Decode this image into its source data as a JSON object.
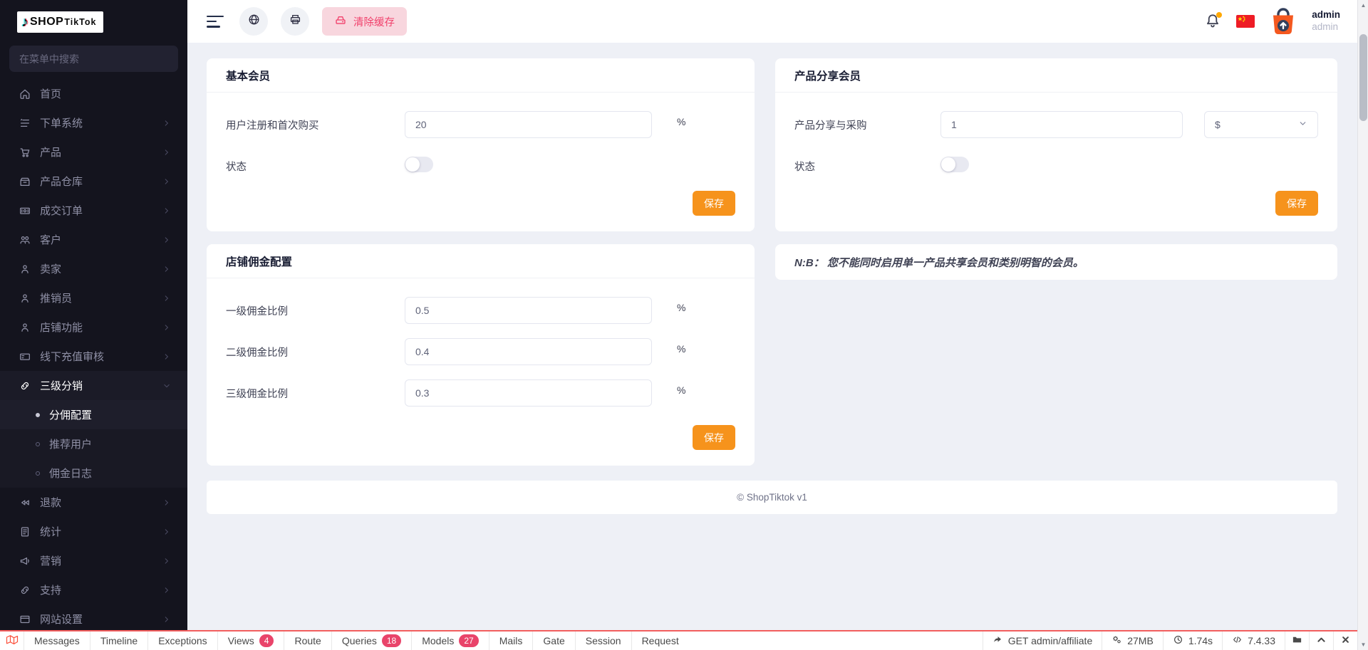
{
  "brand": {
    "shop": "SHOP",
    "tiktok": "TikTok"
  },
  "sidebar": {
    "search_placeholder": "在菜单中搜索",
    "items": [
      {
        "label": "首页",
        "icon": "home-icon"
      },
      {
        "label": "下单系统",
        "icon": "order-list-icon"
      },
      {
        "label": "产品",
        "icon": "cart-icon"
      },
      {
        "label": "产品仓库",
        "icon": "warehouse-icon"
      },
      {
        "label": "成交订单",
        "icon": "order-receipt-icon"
      },
      {
        "label": "客户",
        "icon": "customers-icon"
      },
      {
        "label": "卖家",
        "icon": "user-icon"
      },
      {
        "label": "推销员",
        "icon": "user-icon"
      },
      {
        "label": "店铺功能",
        "icon": "user-icon"
      },
      {
        "label": "线下充值审核",
        "icon": "card-icon"
      },
      {
        "label": "三级分销",
        "icon": "link-icon",
        "expanded": true,
        "children": [
          {
            "label": "分佣配置",
            "active": true
          },
          {
            "label": "推荐用户",
            "active": false
          },
          {
            "label": "佣金日志",
            "active": false
          }
        ]
      },
      {
        "label": "退款",
        "icon": "rewind-icon"
      },
      {
        "label": "统计",
        "icon": "file-icon"
      },
      {
        "label": "营销",
        "icon": "megaphone-icon"
      },
      {
        "label": "支持",
        "icon": "link-icon"
      },
      {
        "label": "网站设置",
        "icon": "window-icon"
      }
    ]
  },
  "header": {
    "clear_cache_label": "清除缓存",
    "user": {
      "name": "admin",
      "role": "admin"
    }
  },
  "cards": {
    "basic_member": {
      "title": "基本会员",
      "field_label": "用户注册和首次购买",
      "field_value": "20",
      "unit": "%",
      "status_label": "状态",
      "save_label": "保存"
    },
    "product_share_member": {
      "title": "产品分享会员",
      "field_label": "产品分享与采购",
      "field_value": "1",
      "currency": "$",
      "status_label": "状态",
      "save_label": "保存"
    },
    "shop_commission": {
      "title": "店铺佣金配置",
      "save_label": "保存",
      "rows": [
        {
          "label": "一级佣金比例",
          "value": "0.5",
          "unit": "%"
        },
        {
          "label": "二级佣金比例",
          "value": "0.4",
          "unit": "%"
        },
        {
          "label": "三级佣金比例",
          "value": "0.3",
          "unit": "%"
        }
      ]
    },
    "note": {
      "text": "N:B： 您不能同时启用单一产品共享会员和类别明智的会员。"
    }
  },
  "footer": {
    "copyright": "© ShopTiktok v1"
  },
  "debugbar": {
    "tabs": [
      {
        "label": "Messages"
      },
      {
        "label": "Timeline"
      },
      {
        "label": "Exceptions"
      },
      {
        "label": "Views",
        "badge": "4"
      },
      {
        "label": "Route"
      },
      {
        "label": "Queries",
        "badge": "18"
      },
      {
        "label": "Models",
        "badge": "27"
      },
      {
        "label": "Mails"
      },
      {
        "label": "Gate"
      },
      {
        "label": "Session"
      },
      {
        "label": "Request"
      }
    ],
    "request": "GET admin/affiliate",
    "memory": "27MB",
    "time": "1.74s",
    "php_version": "7.4.33"
  },
  "colors": {
    "accent_orange": "#f6931c",
    "danger_pink": "#f1416c",
    "sidebar_bg": "#14141e",
    "content_bg": "#eef0f6",
    "debug_red": "#f25e5e",
    "badge_red": "#e9446a",
    "notification_dot": "#ffa800"
  }
}
